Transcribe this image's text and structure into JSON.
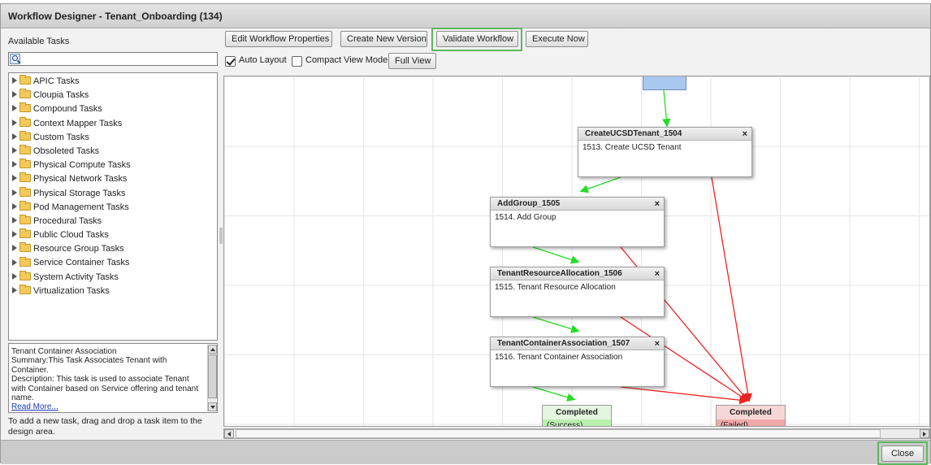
{
  "window": {
    "title": "Workflow Designer - Tenant_Onboarding (134)"
  },
  "left_panel": {
    "header": "Available Tasks",
    "search": {
      "value": "",
      "placeholder": ""
    },
    "tree_items": [
      "APIC Tasks",
      "Cloupia Tasks",
      "Compound Tasks",
      "Context Mapper Tasks",
      "Custom Tasks",
      "Obsoleted Tasks",
      "Physical Compute Tasks",
      "Physical Network Tasks",
      "Physical Storage Tasks",
      "Pod Management Tasks",
      "Procedural Tasks",
      "Public Cloud Tasks",
      "Resource Group Tasks",
      "Service Container Tasks",
      "System Activity Tasks",
      "Virtualization Tasks"
    ],
    "description": {
      "title": "Tenant Container Association",
      "summary": "Summary:This Task Associates Tenant with Container.",
      "description": "Description: This task is used to associate Tenant with Container based on Service offering and tenant name.",
      "read_more": "Read More..."
    },
    "hint": "To add a new task, drag and drop a task item to the design area."
  },
  "toolbar": {
    "edit_properties": "Edit Workflow Properties",
    "create_version": "Create New Version",
    "validate": "Validate Workflow",
    "execute": "Execute Now",
    "auto_layout": "Auto Layout",
    "auto_layout_checked": true,
    "compact_view": "Compact View Mode",
    "compact_view_checked": false,
    "full_view": "Full View"
  },
  "canvas": {
    "nodes": [
      {
        "title": "CreateUCSDTenant_1504",
        "body": "1513. Create UCSD Tenant",
        "close": "×"
      },
      {
        "title": "AddGroup_1505",
        "body": "1514. Add Group",
        "close": "×"
      },
      {
        "title": "TenantResourceAllocation_1506",
        "body": "1515. Tenant Resource Allocation",
        "close": "×"
      },
      {
        "title": "TenantContainerAssociation_1507",
        "body": "1516. Tenant Container Association",
        "close": "×"
      }
    ],
    "end_success": {
      "title": "Completed",
      "status": "(Success)"
    },
    "end_failed": {
      "title": "Completed",
      "status": "(Failed)"
    },
    "colors": {
      "success_line": "#22dd22",
      "failure_line": "#ee2222",
      "start_node": "#a9c8f0"
    }
  },
  "footer": {
    "close": "Close"
  }
}
